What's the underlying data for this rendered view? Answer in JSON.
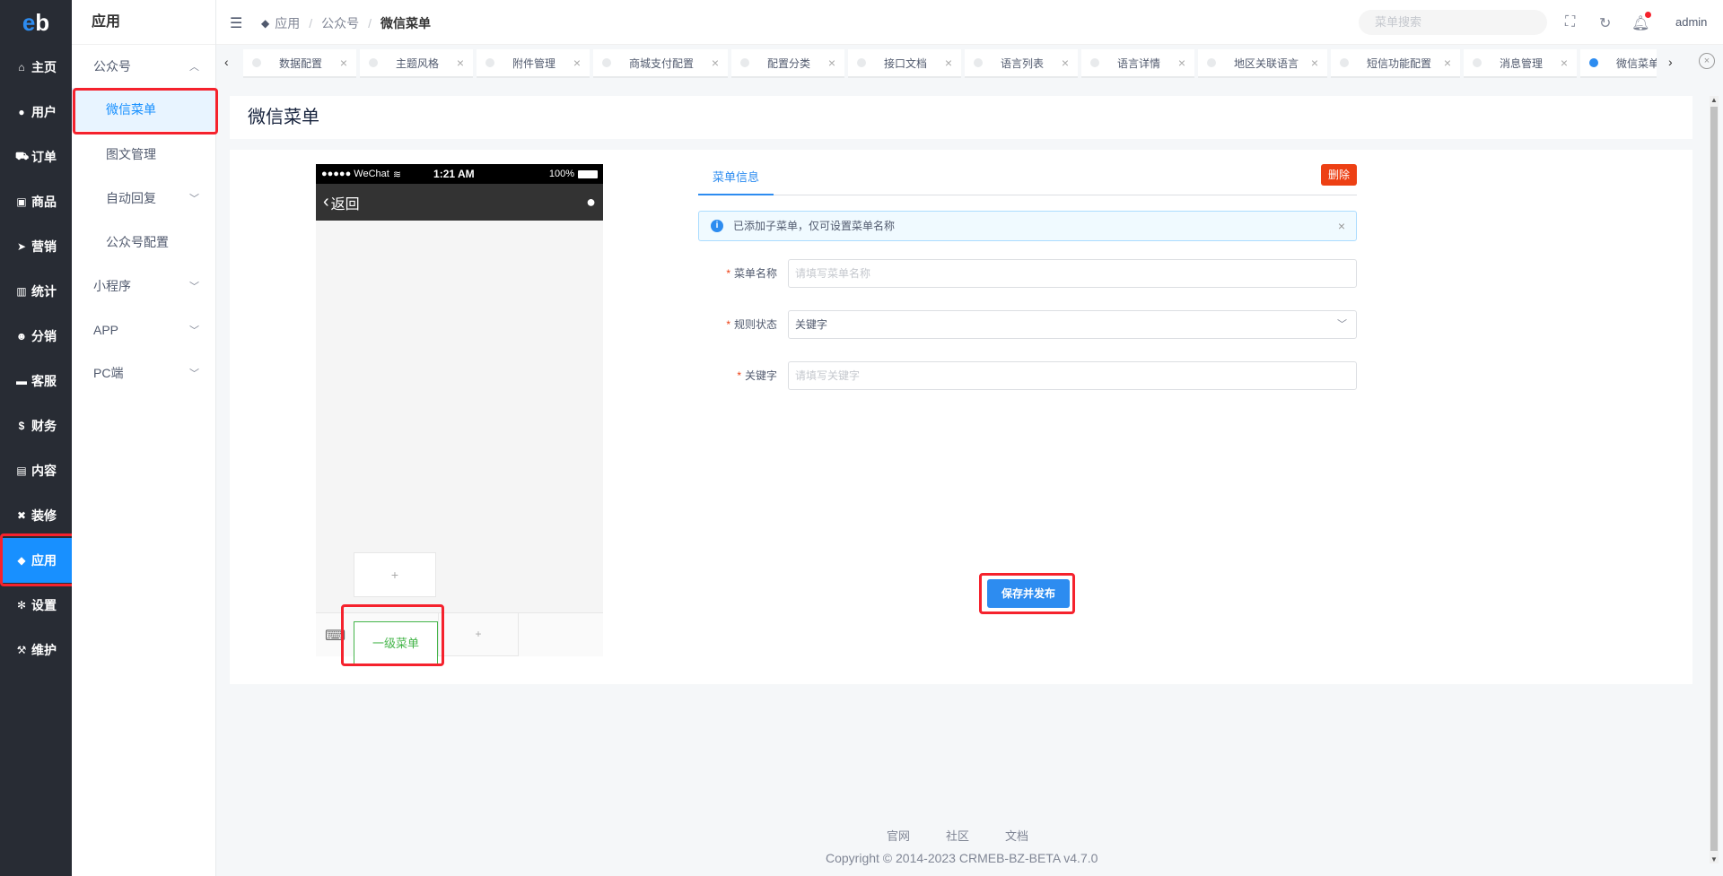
{
  "rail": {
    "logo": "eb",
    "items": [
      {
        "label": "主页",
        "icon": "home-icon"
      },
      {
        "label": "用户",
        "icon": "user-icon"
      },
      {
        "label": "订单",
        "icon": "cart-icon"
      },
      {
        "label": "商品",
        "icon": "shop-icon"
      },
      {
        "label": "营销",
        "icon": "send-icon"
      },
      {
        "label": "统计",
        "icon": "chart-icon"
      },
      {
        "label": "分销",
        "icon": "team-icon"
      },
      {
        "label": "客服",
        "icon": "chat-icon"
      },
      {
        "label": "财务",
        "icon": "dollar-icon"
      },
      {
        "label": "内容",
        "icon": "book-icon"
      },
      {
        "label": "装修",
        "icon": "tools-icon"
      },
      {
        "label": "应用",
        "icon": "cube-icon"
      },
      {
        "label": "设置",
        "icon": "gear-icon"
      },
      {
        "label": "维护",
        "icon": "hammer-icon"
      }
    ],
    "active_index": 11
  },
  "submenu": {
    "title": "应用",
    "items": [
      {
        "label": "公众号",
        "level": 1,
        "expanded": true
      },
      {
        "label": "微信菜单",
        "level": 2,
        "active": true
      },
      {
        "label": "图文管理",
        "level": 2
      },
      {
        "label": "自动回复",
        "level": 2,
        "has_children": true
      },
      {
        "label": "公众号配置",
        "level": 2
      },
      {
        "label": "小程序",
        "level": 1,
        "has_children": true
      },
      {
        "label": "APP",
        "level": 1,
        "has_children": true
      },
      {
        "label": "PC端",
        "level": 1,
        "has_children": true
      }
    ]
  },
  "header": {
    "breadcrumb": [
      "应用",
      "公众号",
      "微信菜单"
    ],
    "search_placeholder": "菜单搜索",
    "user": "admin"
  },
  "tabs": [
    {
      "label": "数据配置"
    },
    {
      "label": "主题风格"
    },
    {
      "label": "附件管理"
    },
    {
      "label": "商城支付配置"
    },
    {
      "label": "配置分类"
    },
    {
      "label": "接口文档"
    },
    {
      "label": "语言列表"
    },
    {
      "label": "语言详情"
    },
    {
      "label": "地区关联语言"
    },
    {
      "label": "短信功能配置"
    },
    {
      "label": "消息管理"
    },
    {
      "label": "微信菜单",
      "active": true
    }
  ],
  "page": {
    "title": "微信菜单"
  },
  "phone": {
    "carrier": "●●●●● WeChat",
    "time": "1:21 AM",
    "battery": "100%",
    "back_label": "返回",
    "sub_add": "+",
    "menu_item": "一级菜单",
    "menu_add": "+"
  },
  "form": {
    "tab": "菜单信息",
    "delete_label": "删除",
    "alert": "已添加子菜单，仅可设置菜单名称",
    "fields": [
      {
        "label": "菜单名称",
        "placeholder": "请填写菜单名称",
        "value": ""
      },
      {
        "label": "规则状态",
        "placeholder": "",
        "value": "关键字"
      },
      {
        "label": "关键字",
        "placeholder": "请填写关键字",
        "value": ""
      }
    ],
    "save_label": "保存并发布"
  },
  "footer": {
    "links": [
      "官网",
      "社区",
      "文档"
    ],
    "copyright": "Copyright © 2014-2023 CRMEB-BZ-BETA v4.7.0"
  },
  "colors": {
    "rail_bg": "#282c34",
    "primary": "#2d8cf0",
    "danger": "#ed4014",
    "wechat_green": "#44b549",
    "highlight_box": "#f5222d"
  }
}
